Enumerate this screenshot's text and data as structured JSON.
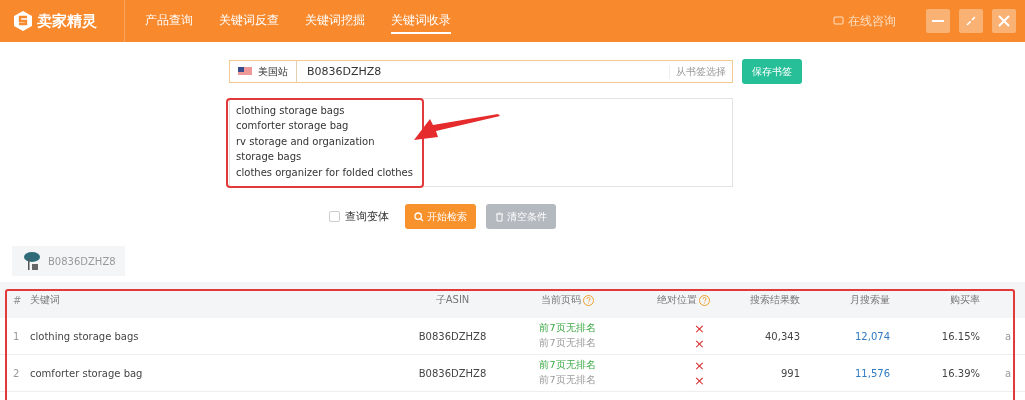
{
  "header": {
    "logo": "卖家精灵",
    "nav": [
      {
        "label": "产品查询",
        "selected": false
      },
      {
        "label": "关键词反查",
        "selected": false
      },
      {
        "label": "关键词挖掘",
        "selected": false
      },
      {
        "label": "关键词收录",
        "selected": true
      }
    ],
    "consult": "在线咨询"
  },
  "query": {
    "site": "美国站",
    "asin": "B0836DZHZ8",
    "bookmark_pick": "从书签选择",
    "save": "保存书签",
    "keywords": [
      "clothing storage bags",
      "comforter storage bag",
      "rv storage and organization",
      "storage bags",
      "clothes organizer for folded clothes"
    ],
    "variant": {
      "label": "查询变体",
      "checked": false
    },
    "search": "开始检索",
    "clear": {
      "label": "清空条件",
      "disabled": true
    }
  },
  "result_tab": {
    "label": "B0836DZHZ8"
  },
  "table": {
    "columns": [
      "#",
      "关键词",
      "子ASIN",
      "当前页码",
      "绝对位置",
      "搜索结果数",
      "月搜索量",
      "购买率"
    ],
    "rows": [
      {
        "index": "1",
        "keyword": "clothing storage bags",
        "child_asin": "B0836DZHZ8",
        "current_page": [
          "前7页无排名",
          "前7页无排名"
        ],
        "absolute_position": [
          "×",
          "×"
        ],
        "search_results": "40,343",
        "monthly_searches": "12,074",
        "purchase_rate": "16.15%",
        "column_9": "a"
      },
      {
        "index": "2",
        "keyword": "comforter storage bag",
        "child_asin": "B0836DZHZ8",
        "current_page": [
          "前7页无排名",
          "前7页无排名"
        ],
        "absolute_position": [
          "×",
          "×"
        ],
        "search_results": "991",
        "monthly_searches": "11,576",
        "purchase_rate": "16.39%",
        "column_9": "a"
      }
    ]
  }
}
